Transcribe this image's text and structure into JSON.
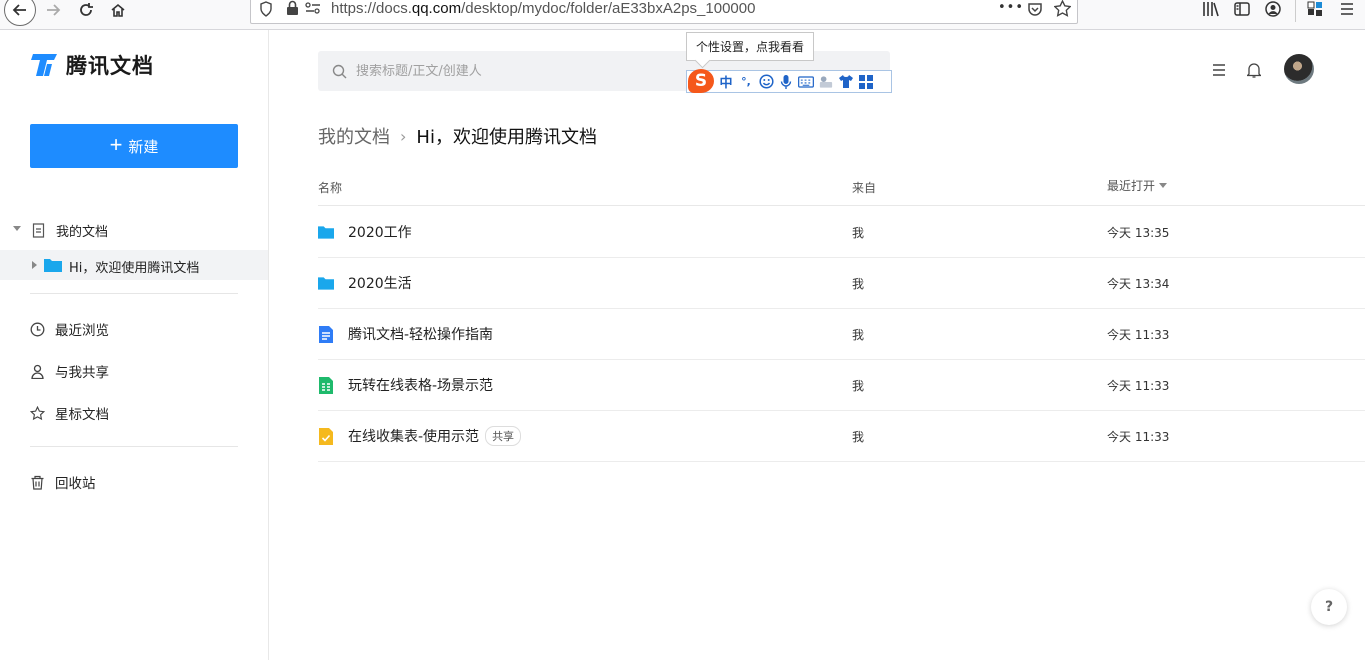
{
  "browser": {
    "url_prefix": "https://docs.",
    "url_domain": "qq.com",
    "url_path": "/desktop/mydoc/folder/aE33bxA2ps_100000",
    "url_more": "•••"
  },
  "sidebar": {
    "logo_text": "腾讯文档",
    "new_button": "新建",
    "tree": {
      "root_label": "我的文档",
      "child_label": "Hi，欢迎使用腾讯文档"
    },
    "nav": [
      {
        "label": "最近浏览",
        "icon": "clock-icon"
      },
      {
        "label": "与我共享",
        "icon": "person-icon"
      },
      {
        "label": "星标文档",
        "icon": "star-icon"
      }
    ],
    "trash_label": "回收站"
  },
  "search": {
    "placeholder": "搜索标题/正文/创建人"
  },
  "ime": {
    "tooltip": "个性设置，点我看看",
    "logo": "S",
    "lang": "中",
    "punct": "°,"
  },
  "breadcrumb": {
    "root": "我的文档",
    "separator": "›",
    "current": "Hi，欢迎使用腾讯文档"
  },
  "table": {
    "headers": {
      "name": "名称",
      "from": "来自",
      "opened": "最近打开"
    },
    "rows": [
      {
        "name": "2020工作",
        "type": "folder",
        "from": "我",
        "time": "今天 13:35",
        "tag": ""
      },
      {
        "name": "2020生活",
        "type": "folder",
        "from": "我",
        "time": "今天 13:34",
        "tag": ""
      },
      {
        "name": "腾讯文档-轻松操作指南",
        "type": "doc",
        "from": "我",
        "time": "今天 11:33",
        "tag": ""
      },
      {
        "name": "玩转在线表格-场景示范",
        "type": "sheet",
        "from": "我",
        "time": "今天 11:33",
        "tag": ""
      },
      {
        "name": "在线收集表-使用示范",
        "type": "form",
        "from": "我",
        "time": "今天 11:33",
        "tag": "共享"
      }
    ]
  },
  "help_label": "?",
  "colors": {
    "accent": "#1e8cff",
    "folder": "#1aa7ec",
    "doc": "#2f7cf6",
    "sheet": "#1fba6c",
    "form": "#f5b91e"
  }
}
